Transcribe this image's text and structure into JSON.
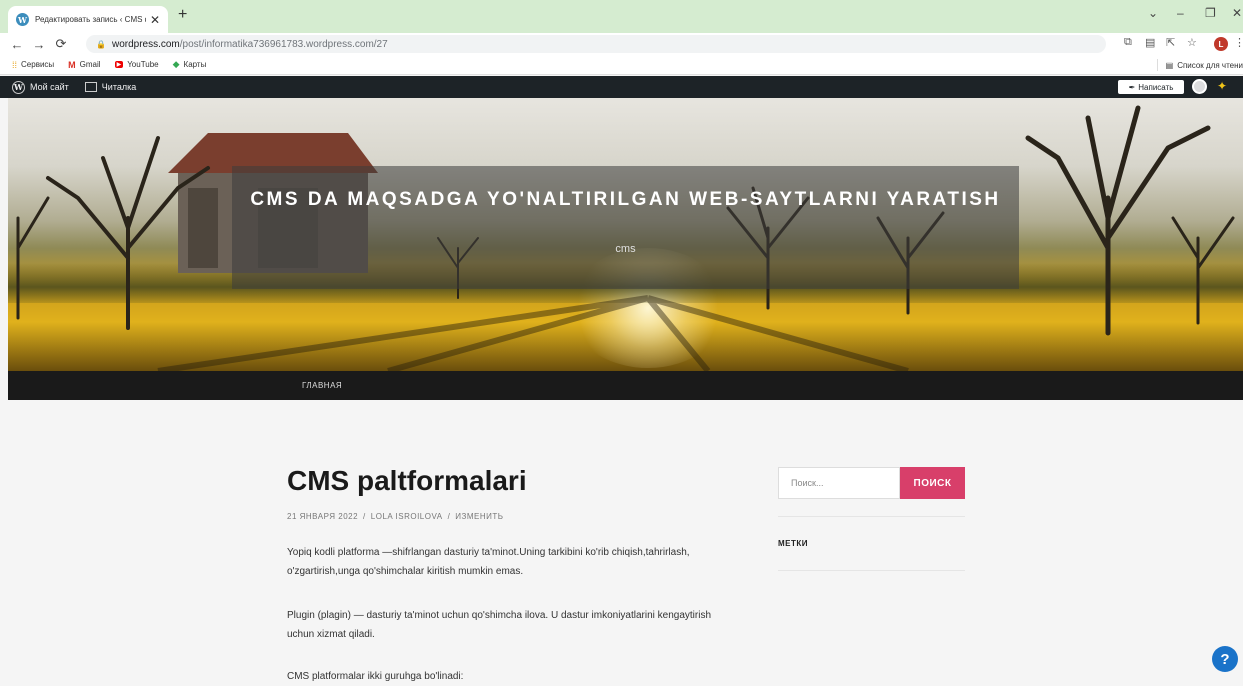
{
  "browser": {
    "tab_title": "Редактировать запись ‹ CMS da",
    "tab_close": "✕",
    "new_tab": "+",
    "window_controls": [
      "⌄",
      "–",
      "❐",
      "✕"
    ],
    "url_host": "wordpress.com",
    "url_path": "/post/informatika736961783.wordpress.com/27",
    "profile_initial": "L",
    "bookmarks": [
      {
        "icon": "apps-icon",
        "label": "Сервисы"
      },
      {
        "icon": "gmail-icon",
        "label": "Gmail"
      },
      {
        "icon": "youtube-icon",
        "label": "YouTube"
      },
      {
        "icon": "maps-icon",
        "label": "Карты"
      }
    ],
    "reading_list": "Список для чтени"
  },
  "adminbar": {
    "my_site": "Мой сайт",
    "reader": "Читалка",
    "write": "Написать"
  },
  "site": {
    "title": "CMS DA MAQSADGA YO'NALTIRILGAN WEB-SAYTLARNI YARATISH",
    "description": "cms",
    "menu": [
      "ГЛАВНАЯ"
    ]
  },
  "post": {
    "title": "CMS paltformalari",
    "date": "21 ЯНВАРЯ 2022",
    "author": "LOLA ISROILOVA",
    "edit": "ИЗМЕНИТЬ",
    "paragraphs": [
      "Yopiq kodli platforma —shifrlangan dasturiy ta'minot.Uning tarkibini ko'rib chiqish,tahrirlash, o'zgartirish,unga qo'shimchalar kiritish mumkin emas.",
      "Plugin (plagin) — dasturiy ta'minot uchun qo'shimcha ilova. U dastur imkoniyatlarini kengaytirish uchun xizmat qiladi.",
      "CMS platformalar ikki guruhga bo'linadi:"
    ]
  },
  "sidebar": {
    "search_placeholder": "Поиск...",
    "search_button": "ПОИСК",
    "tags_title": "МЕТКИ"
  },
  "help": "?",
  "colors": {
    "accent": "#d83f6a",
    "adminbar": "#1d2327",
    "help": "#1a73c9"
  }
}
